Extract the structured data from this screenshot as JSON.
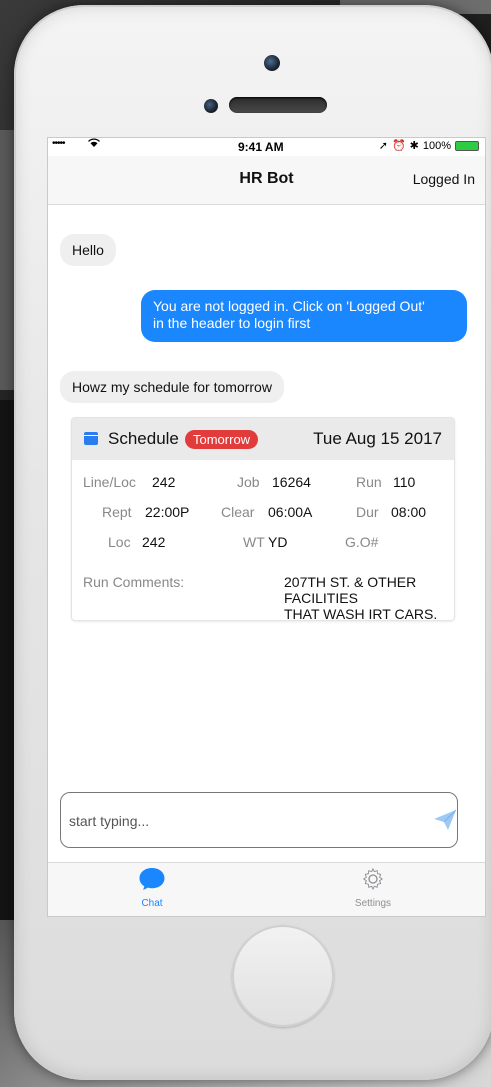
{
  "colors": {
    "accent": "#1a87ff",
    "badge": "#e23b3b",
    "calendar_icon": "#2a7cf0",
    "tab_active": "#1a87ff",
    "tab_inactive": "#8e8e93"
  },
  "status_bar": {
    "signal": "•••••",
    "time": "9:41 AM",
    "battery_percent": "100%"
  },
  "header": {
    "title": "HR Bot",
    "login_label": "Logged In"
  },
  "messages": [
    {
      "from": "user",
      "text": "Hello"
    },
    {
      "from": "bot",
      "line1": "You are not logged in. Click on 'Logged Out'",
      "line2": "in the header to login first"
    },
    {
      "from": "user",
      "text": "Howz my schedule for tomorrow"
    }
  ],
  "schedule_card": {
    "title": "Schedule",
    "badge": "Tomorrow",
    "date": "Tue Aug 15 2017",
    "fields": {
      "line_loc_label": "Line/Loc",
      "line_loc_value": "242",
      "job_label": "Job",
      "job_value": "16264",
      "run_label": "Run",
      "run_value": "110",
      "rept_label": "Rept",
      "rept_value": "22:00P",
      "clear_label": "Clear",
      "clear_value": "06:00A",
      "dur_label": "Dur",
      "dur_value": "08:00",
      "loc_label": "Loc",
      "loc_value": "242",
      "wt_label": "WT",
      "wt_value": "YD",
      "go_label": "G.O#"
    },
    "comments_label": "Run Comments:",
    "comments_line1": "207TH ST. & OTHER FACILITIES",
    "comments_line2": "THAT WASH IRT CARS."
  },
  "composer": {
    "placeholder": "start typing...",
    "icon": "send-icon"
  },
  "tabs": [
    {
      "label": "Chat",
      "icon": "chat-bubble-icon",
      "active": true
    },
    {
      "label": "Settings",
      "icon": "gear-icon",
      "active": false
    }
  ]
}
